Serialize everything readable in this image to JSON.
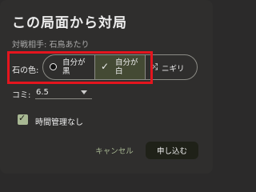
{
  "dialog": {
    "title": "この局面から対局",
    "opponent": "対戦相手: 石鳥あたり"
  },
  "stone_color": {
    "label": "石の色:",
    "options": [
      {
        "line1": "自分が",
        "line2": "黒",
        "icon": "black-stone-icon",
        "selected": false
      },
      {
        "line1": "自分が",
        "line2": "白",
        "icon": "check-icon",
        "selected": true
      },
      {
        "label": "ニギリ",
        "icon": "shuffle-icon",
        "selected": false
      }
    ]
  },
  "komi": {
    "label": "コミ:",
    "value": "6.5"
  },
  "time_control": {
    "label": "時間管理なし",
    "checked": true
  },
  "buttons": {
    "cancel": "キャンセル",
    "submit": "申し込む"
  },
  "colors": {
    "accent": "#a8b893",
    "highlight_border": "#e4151e",
    "selected_segment": "#444a34",
    "background": "#2f2e2d"
  }
}
